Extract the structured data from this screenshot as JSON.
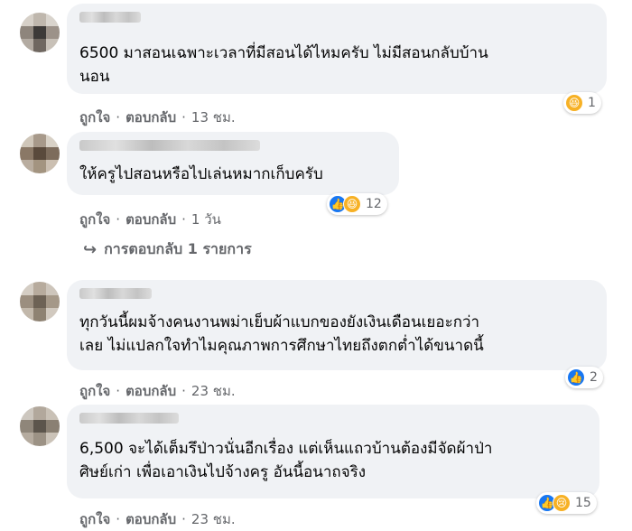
{
  "comments": [
    {
      "text": "6500 มาสอนเฉพาะเวลาที่มีสอนได้ไหมครับ ไม่มีสอนกลับบ้าน\nนอน",
      "reaction_count": "1",
      "reactions": [
        "haha"
      ],
      "like_label": "ถูกใจ",
      "reply_label": "ตอบกลับ",
      "time": "13 ชม."
    },
    {
      "text": "ให้ครูไปสอนหรือไปเล่นหมากเก็บครับ",
      "reaction_count": "12",
      "reactions": [
        "like",
        "haha"
      ],
      "like_label": "ถูกใจ",
      "reply_label": "ตอบกลับ",
      "time": "1 วัน",
      "replies_link": "การตอบกลับ 1 รายการ"
    },
    {
      "text": "ทุกวันนี้ผมจ้างคนงานพม่าเย็บผ้าแบกของยังเงินเดือนเยอะกว่า\nเลย ไม่แปลกใจทำไมคุณภาพการศึกษาไทยถึงตกต่ำได้ขนาดนี้",
      "reaction_count": "2",
      "reactions": [
        "like"
      ],
      "like_label": "ถูกใจ",
      "reply_label": "ตอบกลับ",
      "time": "23 ชม."
    },
    {
      "text": "6,500 จะได้เต็มรึป่าวนั่นอีกเรื่อง แต่เห็นแถวบ้านต้องมีจัดผ้าป่า\nศิษย์เก่า เพื่อเอาเงินไปจ้างครู อันนี้อนาถจริง",
      "reaction_count": "15",
      "reactions": [
        "like",
        "sad"
      ],
      "like_label": "ถูกใจ",
      "reply_label": "ตอบกลับ",
      "time": "23 ชม."
    }
  ],
  "colors": {
    "bubble": "#f0f2f5",
    "secondary_text": "#65676b",
    "like_blue": "#1877f2",
    "haha_yellow": "#f7b125"
  },
  "separator": "·"
}
